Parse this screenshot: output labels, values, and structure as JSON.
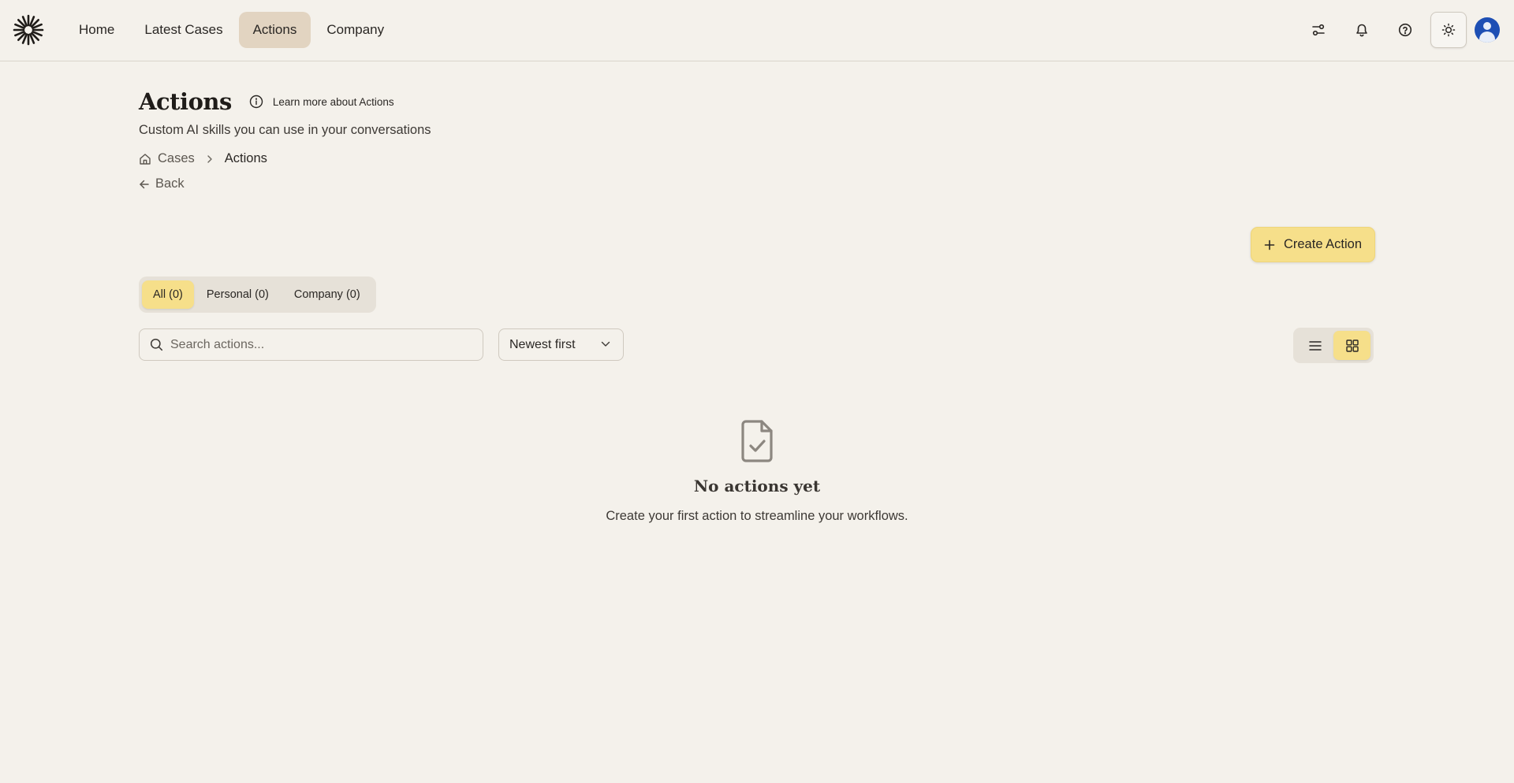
{
  "nav": {
    "items": [
      {
        "label": "Home",
        "active": false
      },
      {
        "label": "Latest Cases",
        "active": false
      },
      {
        "label": "Actions",
        "active": true
      },
      {
        "label": "Company",
        "active": false
      }
    ]
  },
  "header": {
    "title": "Actions",
    "learn_more": "Learn more about Actions",
    "subtitle": "Custom AI skills you can use in your conversations"
  },
  "breadcrumb": {
    "root": "Cases",
    "current": "Actions"
  },
  "back_label": "Back",
  "create_button": "Create Action",
  "filter_tabs": [
    {
      "label": "All (0)",
      "active": true
    },
    {
      "label": "Personal (0)",
      "active": false
    },
    {
      "label": "Company (0)",
      "active": false
    }
  ],
  "search": {
    "placeholder": "Search actions...",
    "value": ""
  },
  "sort": {
    "selected": "Newest first"
  },
  "view_toggle": {
    "selected": "grid"
  },
  "empty_state": {
    "title": "No actions yet",
    "description": "Create your first action to streamline your workflows."
  },
  "colors": {
    "background": "#f4f1eb",
    "accent": "#f6df8a",
    "nav_active": "#e2d4c1",
    "avatar": "#1e4fb4"
  }
}
